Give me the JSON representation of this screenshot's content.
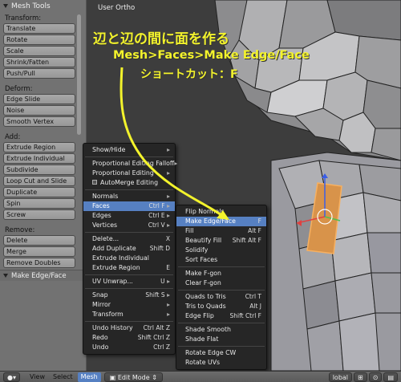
{
  "toolshelf": {
    "title": "Mesh Tools",
    "sections": [
      {
        "label": "Transform:",
        "buttons": [
          "Translate",
          "Rotate",
          "Scale",
          "Shrink/Fatten",
          "Push/Pull"
        ]
      },
      {
        "label": "Deform:",
        "buttons": [
          "Edge Slide",
          "Noise",
          "Smooth Vertex"
        ]
      },
      {
        "label": "Add:",
        "buttons": [
          "Extrude Region",
          "Extrude Individual",
          "Subdivide",
          "Loop Cut and Slide",
          "Duplicate",
          "Spin",
          "Screw"
        ]
      },
      {
        "label": "Remove:",
        "buttons": [
          "Delete",
          "Merge",
          "Remove Doubles"
        ]
      }
    ],
    "last_operator": "Make Edge/Face"
  },
  "viewport": {
    "label": "User Ortho"
  },
  "annotation": {
    "line1": "辺と辺の間に面を作る",
    "line2": "Mesh>Faces>Make Edge/Face",
    "line3": "ショートカット：F",
    "color": "#f3f32c"
  },
  "mesh_menu": {
    "items": [
      {
        "label": "Show/Hide",
        "shortcut": "",
        "sub": true
      },
      {
        "sep": true
      },
      {
        "label": "Proportional Editing Falloff",
        "shortcut": "",
        "sub": true
      },
      {
        "label": "Proportional Editing",
        "shortcut": "",
        "sub": true
      },
      {
        "label": "AutoMerge Editing",
        "shortcut": "",
        "check": true
      },
      {
        "sep": true
      },
      {
        "label": "Normals",
        "shortcut": "",
        "sub": true
      },
      {
        "label": "Faces",
        "shortcut": "Ctrl F",
        "sub": true,
        "hl": true
      },
      {
        "label": "Edges",
        "shortcut": "Ctrl E",
        "sub": true
      },
      {
        "label": "Vertices",
        "shortcut": "Ctrl V",
        "sub": true
      },
      {
        "sep": true
      },
      {
        "label": "Delete...",
        "shortcut": "X"
      },
      {
        "label": "Add Duplicate",
        "shortcut": "Shift D"
      },
      {
        "label": "Extrude Individual",
        "shortcut": ""
      },
      {
        "label": "Extrude Region",
        "shortcut": "E"
      },
      {
        "sep": true
      },
      {
        "label": "UV Unwrap...",
        "shortcut": "U",
        "sub": true
      },
      {
        "sep": true
      },
      {
        "label": "Snap",
        "shortcut": "Shift S",
        "sub": true
      },
      {
        "label": "Mirror",
        "shortcut": "",
        "sub": true
      },
      {
        "label": "Transform",
        "shortcut": "",
        "sub": true
      },
      {
        "sep": true
      },
      {
        "label": "Undo History",
        "shortcut": "Ctrl Alt Z"
      },
      {
        "label": "Redo",
        "shortcut": "Shift Ctrl Z"
      },
      {
        "label": "Undo",
        "shortcut": "Ctrl Z"
      }
    ]
  },
  "faces_menu": {
    "items": [
      {
        "label": "Flip Normals",
        "shortcut": ""
      },
      {
        "label": "Make Edge/Face",
        "shortcut": "F",
        "hl": true
      },
      {
        "label": "Fill",
        "shortcut": "Alt F"
      },
      {
        "label": "Beautify Fill",
        "shortcut": "Shift Alt F"
      },
      {
        "label": "Solidify",
        "shortcut": ""
      },
      {
        "label": "Sort Faces",
        "shortcut": ""
      },
      {
        "sep": true
      },
      {
        "label": "Make F-gon",
        "shortcut": ""
      },
      {
        "label": "Clear F-gon",
        "shortcut": ""
      },
      {
        "sep": true
      },
      {
        "label": "Quads to Tris",
        "shortcut": "Ctrl T"
      },
      {
        "label": "Tris to Quads",
        "shortcut": "Alt J"
      },
      {
        "label": "Edge Flip",
        "shortcut": "Shift Ctrl F"
      },
      {
        "sep": true
      },
      {
        "label": "Shade Smooth",
        "shortcut": ""
      },
      {
        "label": "Shade Flat",
        "shortcut": ""
      },
      {
        "sep": true
      },
      {
        "label": "Rotate Edge CW",
        "shortcut": ""
      },
      {
        "label": "Rotate UVs",
        "shortcut": ""
      }
    ]
  },
  "header": {
    "view": "View",
    "select": "Select",
    "mesh": "Mesh",
    "mode": "Edit Mode",
    "orientation": "lobal"
  }
}
